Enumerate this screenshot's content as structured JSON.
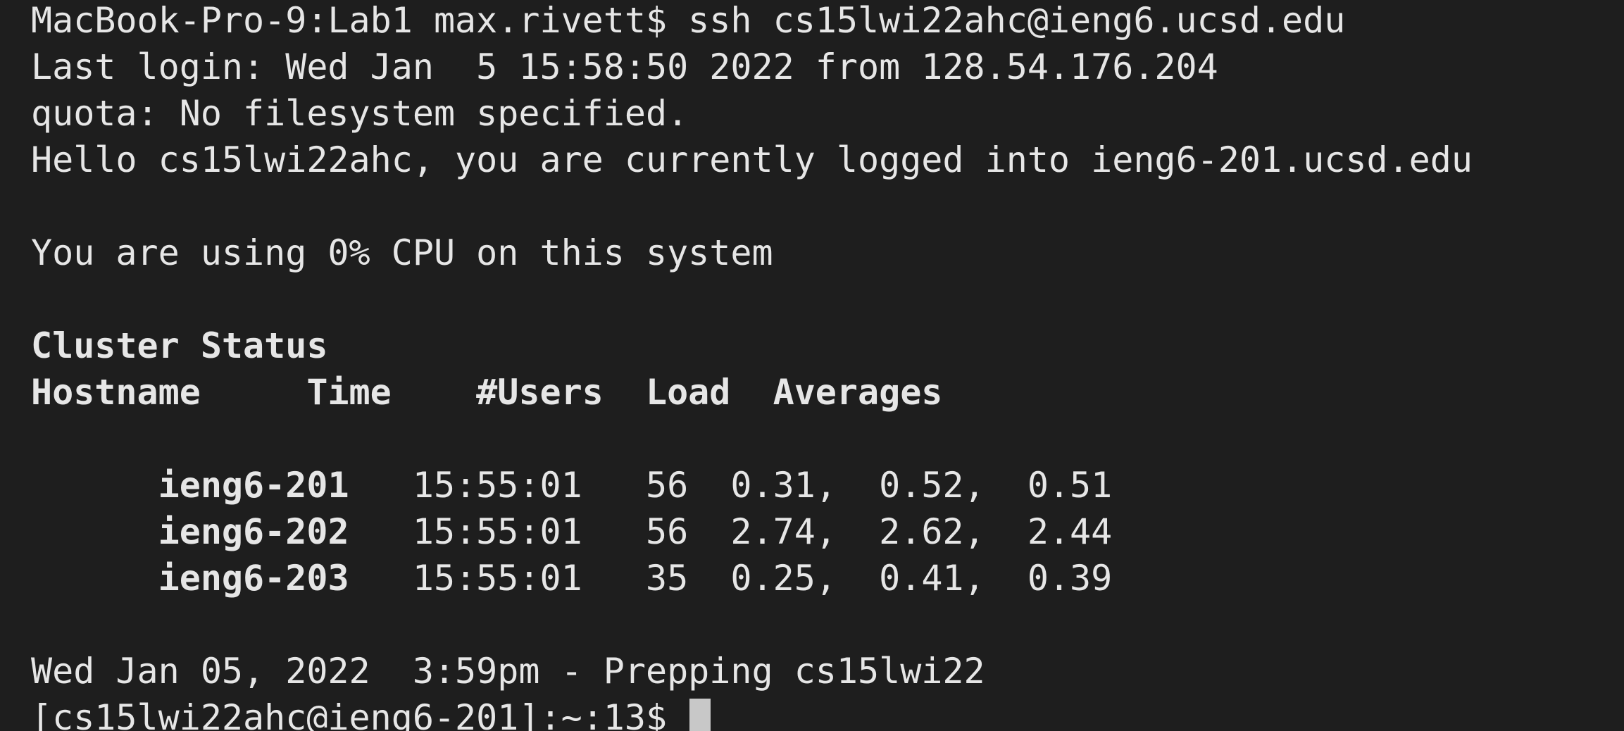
{
  "terminal": {
    "ssh_command_line": "MacBook-Pro-9:Lab1 max.rivett$ ssh cs15lwi22ahc@ieng6.ucsd.edu",
    "last_login": "Last login: Wed Jan  5 15:58:50 2022 from 128.54.176.204",
    "quota": "quota: No filesystem specified.",
    "hello": "Hello cs15lwi22ahc, you are currently logged into ieng6-201.ucsd.edu",
    "cpu": "You are using 0% CPU on this system",
    "cluster_status_title": "Cluster Status",
    "cluster_header": "Hostname     Time    #Users  Load  Averages",
    "cluster_rows": [
      {
        "host": "ieng6-201",
        "rest": "   15:55:01   56  0.31,  0.52,  0.51"
      },
      {
        "host": "ieng6-202",
        "rest": "   15:55:01   56  2.74,  2.62,  2.44"
      },
      {
        "host": "ieng6-203",
        "rest": "   15:55:01   35  0.25,  0.41,  0.39"
      }
    ],
    "prep_line": "Wed Jan 05, 2022  3:59pm - Prepping cs15lwi22",
    "prompt": "[cs15lwi22ahc@ieng6-201]:~:13$ "
  },
  "colors": {
    "background": "#1e1e1e",
    "foreground": "#e6e6e6",
    "cursor": "#c8c8c8"
  }
}
